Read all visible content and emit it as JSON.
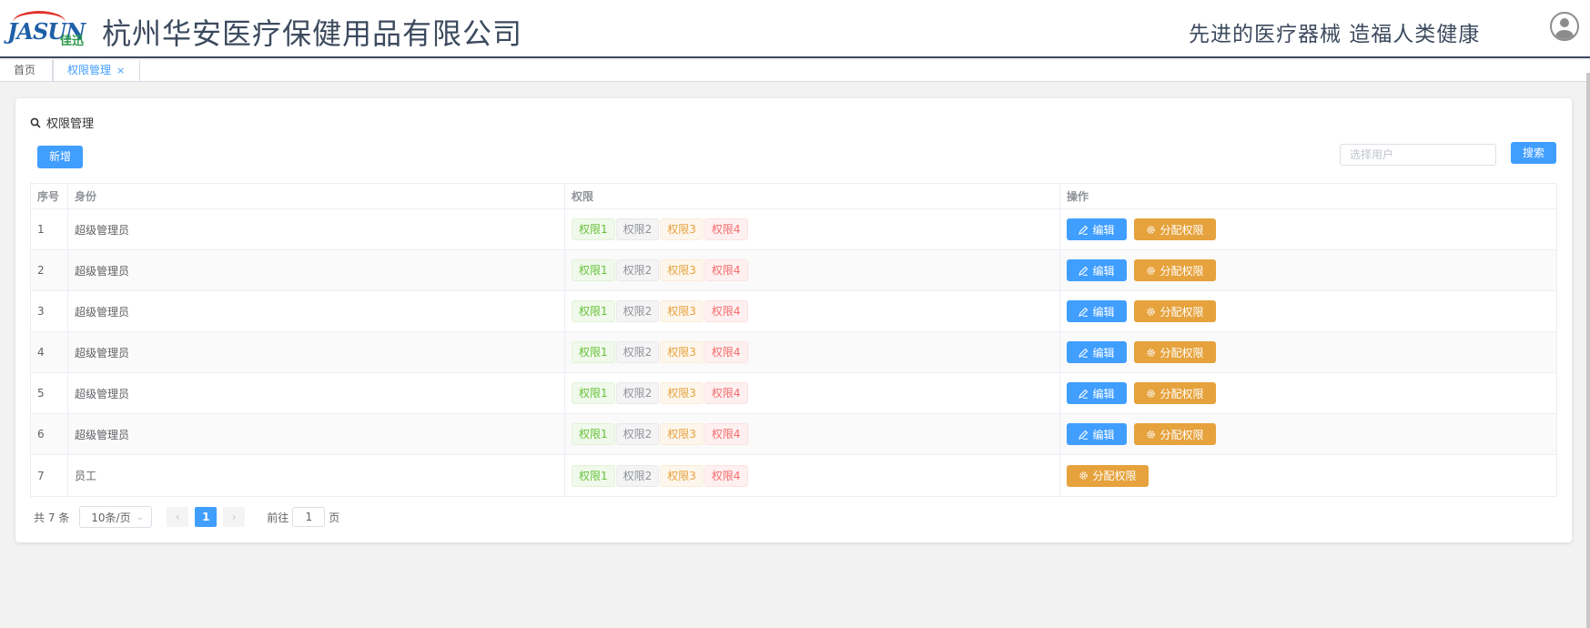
{
  "header": {
    "logo_text": "JASUN",
    "logo_cn": "佳迅",
    "company": "杭州华安医疗保健用品有限公司",
    "slogan": "先进的医疗器械  造福人类健康"
  },
  "tabs": [
    {
      "label": "首页"
    },
    {
      "label": "权限管理",
      "close": "×"
    }
  ],
  "card": {
    "title": "权限管理",
    "add_label": "新增",
    "search_placeholder": "选择用户",
    "search_label": "搜索"
  },
  "table": {
    "headers": [
      "序号",
      "身份",
      "权限",
      "操作"
    ],
    "tags": [
      "权限1",
      "权限2",
      "权限3",
      "权限4"
    ],
    "edit_label": "编辑",
    "assign_label": "分配权限",
    "rows": [
      {
        "no": "1",
        "role": "超级管理员"
      },
      {
        "no": "2",
        "role": "超级管理员"
      },
      {
        "no": "3",
        "role": "超级管理员"
      },
      {
        "no": "4",
        "role": "超级管理员"
      },
      {
        "no": "5",
        "role": "超级管理员"
      },
      {
        "no": "6",
        "role": "超级管理员"
      },
      {
        "no": "7",
        "role": "员工"
      }
    ]
  },
  "pagination": {
    "total": "共 7 条",
    "page_size": "10条/页",
    "current_page": "1",
    "goto_label": "前往",
    "goto_value": "1",
    "goto_suffix": "页"
  },
  "colors": {
    "primary": "#409eff",
    "warning": "#e6a23c",
    "success": "#67c23a",
    "danger": "#f56c6c",
    "header_text": "#3c4a5e"
  }
}
